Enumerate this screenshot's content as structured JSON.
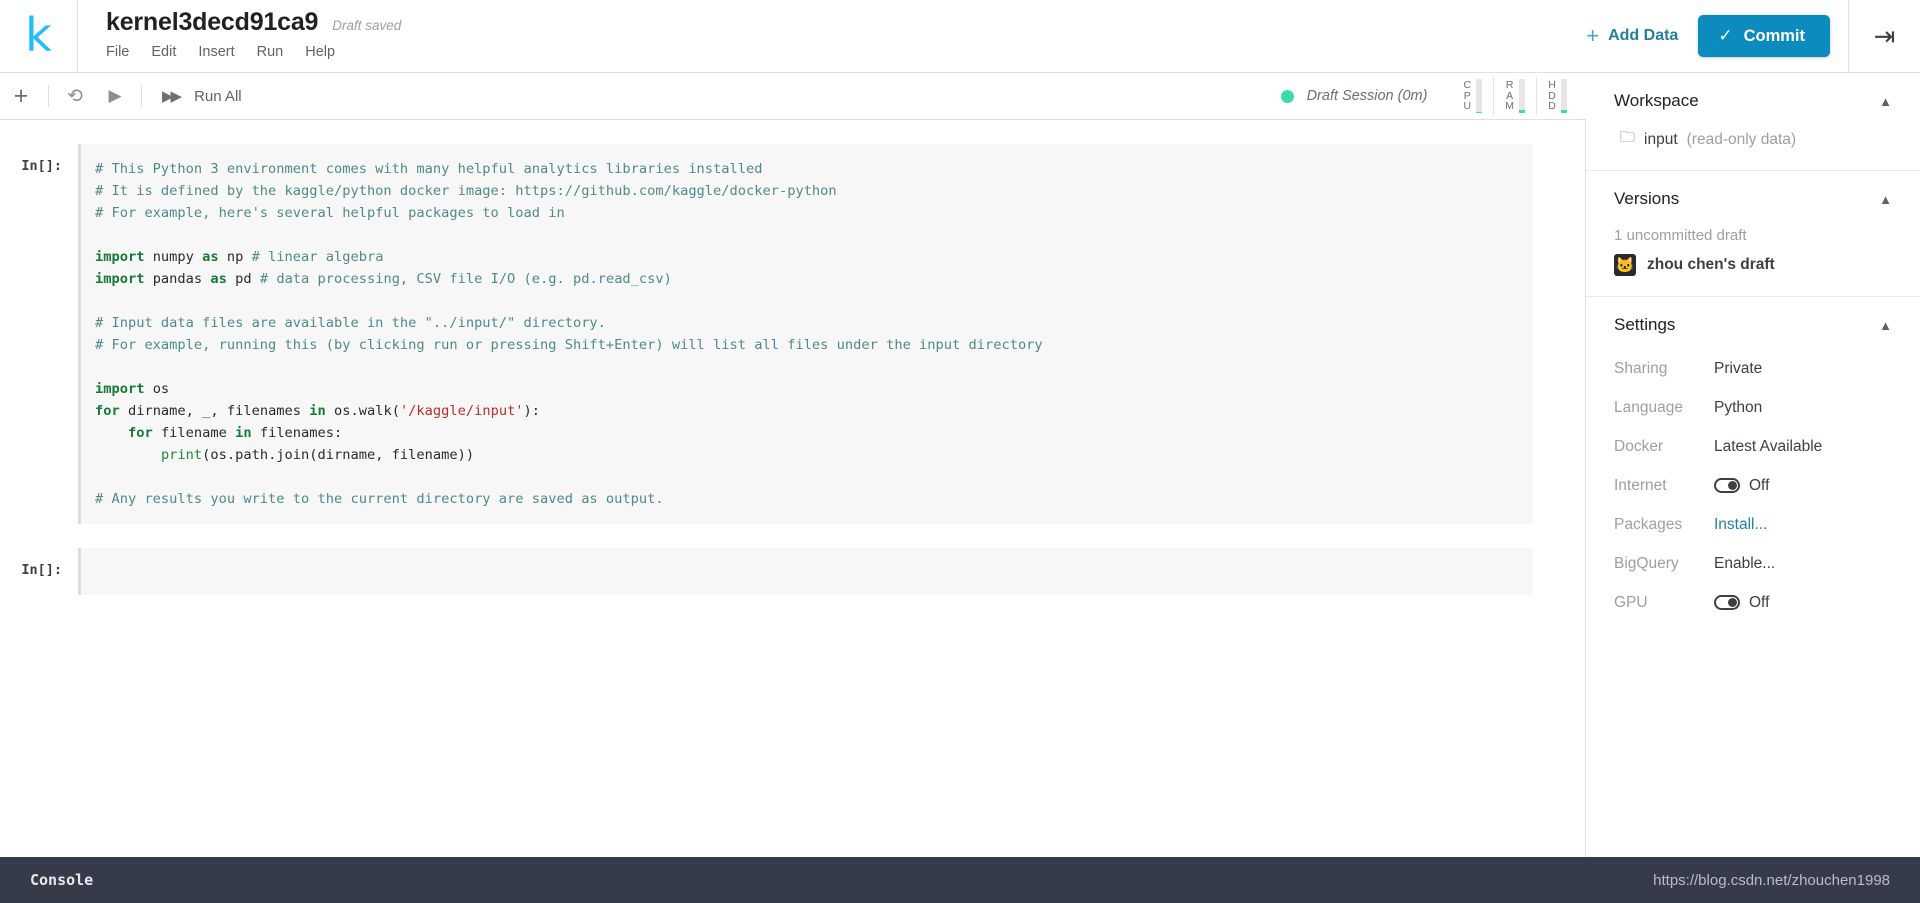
{
  "header": {
    "logo": "k",
    "kernel_title": "kernel3decd91ca9",
    "draft_status": "Draft saved",
    "menu": [
      {
        "label": "File"
      },
      {
        "label": "Edit"
      },
      {
        "label": "Insert"
      },
      {
        "label": "Run"
      },
      {
        "label": "Help"
      }
    ],
    "add_data_label": "Add Data",
    "add_data_icon": "+",
    "commit_label": "Commit",
    "commit_icon": "✓",
    "commit_color": "#0c8bbf",
    "collapse_icon": "→|"
  },
  "toolbar": {
    "add_cell_icon": "+",
    "restart_icon": "↻",
    "run_icon": "▶",
    "run_all_icon": "▶▶",
    "run_all_label": "Run All",
    "session_status": "Draft Session (0m)",
    "session_dot_color": "#3ddbab",
    "meters": [
      {
        "name": "CPU",
        "lines": "C\nP\nU",
        "fill_percent": 4
      },
      {
        "name": "RAM",
        "lines": "R\nA\nM",
        "fill_percent": 9
      },
      {
        "name": "HDD",
        "lines": "H\nD\nD",
        "fill_percent": 9
      }
    ]
  },
  "notebook": {
    "cells": [
      {
        "prompt": "In[]:",
        "type": "code",
        "lines": [
          {
            "segments": [
              {
                "t": "# This Python 3 environment comes with many helpful analytics libraries installed",
                "c": "cm"
              }
            ]
          },
          {
            "segments": [
              {
                "t": "# It is defined by the kaggle/python docker image: https://github.com/kaggle/docker-python",
                "c": "cm"
              }
            ]
          },
          {
            "segments": [
              {
                "t": "# For example, here's several helpful packages to load in",
                "c": "cm"
              }
            ]
          },
          {
            "segments": [
              {
                "t": "",
                "c": ""
              }
            ]
          },
          {
            "segments": [
              {
                "t": "import",
                "c": "kw"
              },
              {
                "t": " numpy ",
                "c": ""
              },
              {
                "t": "as",
                "c": "kw"
              },
              {
                "t": " np ",
                "c": ""
              },
              {
                "t": "# linear algebra",
                "c": "cm"
              }
            ]
          },
          {
            "segments": [
              {
                "t": "import",
                "c": "kw"
              },
              {
                "t": " pandas ",
                "c": ""
              },
              {
                "t": "as",
                "c": "kw"
              },
              {
                "t": " pd ",
                "c": ""
              },
              {
                "t": "# data processing, CSV file I/O (e.g. pd.read_csv)",
                "c": "cm"
              }
            ]
          },
          {
            "segments": [
              {
                "t": "",
                "c": ""
              }
            ]
          },
          {
            "segments": [
              {
                "t": "# Input data files are available in the \"../input/\" directory.",
                "c": "cm"
              }
            ]
          },
          {
            "segments": [
              {
                "t": "# For example, running this (by clicking run or pressing Shift+Enter) will list all files under the input directory",
                "c": "cm"
              }
            ]
          },
          {
            "segments": [
              {
                "t": "",
                "c": ""
              }
            ]
          },
          {
            "segments": [
              {
                "t": "import",
                "c": "kw"
              },
              {
                "t": " os",
                "c": ""
              }
            ]
          },
          {
            "segments": [
              {
                "t": "for",
                "c": "kw"
              },
              {
                "t": " dirname, _, filenames ",
                "c": ""
              },
              {
                "t": "in",
                "c": "kw"
              },
              {
                "t": " os.walk(",
                "c": ""
              },
              {
                "t": "'/kaggle/input'",
                "c": "st"
              },
              {
                "t": "):",
                "c": ""
              }
            ]
          },
          {
            "segments": [
              {
                "t": "    ",
                "c": ""
              },
              {
                "t": "for",
                "c": "kw"
              },
              {
                "t": " filename ",
                "c": ""
              },
              {
                "t": "in",
                "c": "kw"
              },
              {
                "t": " filenames:",
                "c": ""
              }
            ]
          },
          {
            "segments": [
              {
                "t": "        ",
                "c": ""
              },
              {
                "t": "print",
                "c": "bi"
              },
              {
                "t": "(os.path.join(dirname, filename))",
                "c": ""
              }
            ]
          },
          {
            "segments": [
              {
                "t": "",
                "c": ""
              }
            ]
          },
          {
            "segments": [
              {
                "t": "# Any results you write to the current directory are saved as output.",
                "c": "cm"
              }
            ]
          }
        ]
      },
      {
        "prompt": "In[]:",
        "type": "empty",
        "lines": []
      }
    ]
  },
  "sidebar": {
    "workspace": {
      "title": "Workspace",
      "chevron": "⌃",
      "folder_icon": "὜0",
      "item_name": "input",
      "item_note": "(read-only data)"
    },
    "versions": {
      "title": "Versions",
      "chevron": "⌃",
      "subtitle": "1 uncommitted draft",
      "draft_name": "zhou chen's draft",
      "avatar_glyph": "🐱"
    },
    "settings": {
      "title": "Settings",
      "chevron": "⌃",
      "rows": [
        {
          "key": "Sharing",
          "value": "Private",
          "kind": "text"
        },
        {
          "key": "Language",
          "value": "Python",
          "kind": "text"
        },
        {
          "key": "Docker",
          "value": "Latest Available",
          "kind": "text"
        },
        {
          "key": "Internet",
          "value": "Off",
          "kind": "toggle"
        },
        {
          "key": "Packages",
          "value": "Install...",
          "kind": "link"
        },
        {
          "key": "BigQuery",
          "value": "Enable...",
          "kind": "text"
        },
        {
          "key": "GPU",
          "value": "Off",
          "kind": "toggle"
        }
      ]
    }
  },
  "console": {
    "label": "Console",
    "watermark": "https://blog.csdn.net/zhouchen1998"
  }
}
